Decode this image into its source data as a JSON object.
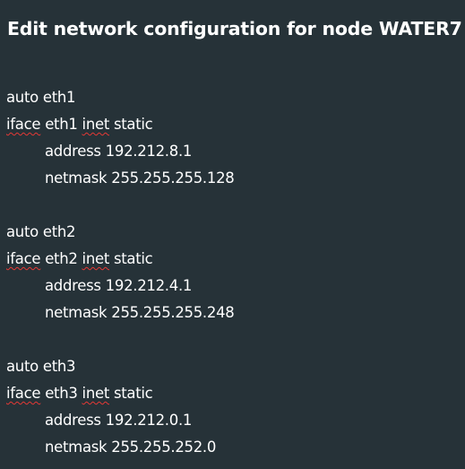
{
  "title": "Edit network configuration for node WATER7",
  "config": {
    "blocks": [
      {
        "auto": "auto eth1",
        "iface_keyword": "iface",
        "iface_name": "eth1",
        "inet_keyword": "inet",
        "method": "static",
        "address": "address 192.212.8.1",
        "netmask": "netmask 255.255.255.128"
      },
      {
        "auto": "auto eth2",
        "iface_keyword": "iface",
        "iface_name": "eth2",
        "inet_keyword": "inet",
        "method": "static",
        "address": "address 192.212.4.1",
        "netmask": "netmask 255.255.255.248"
      },
      {
        "auto": "auto eth3",
        "iface_keyword": "iface",
        "iface_name": "eth3",
        "inet_keyword": "inet",
        "method": "static",
        "address": "address 192.212.0.1",
        "netmask": "netmask 255.255.252.0"
      }
    ]
  },
  "colors": {
    "background": "#263238",
    "text": "#ffffff",
    "spellcheck_underline": "#e53935"
  }
}
